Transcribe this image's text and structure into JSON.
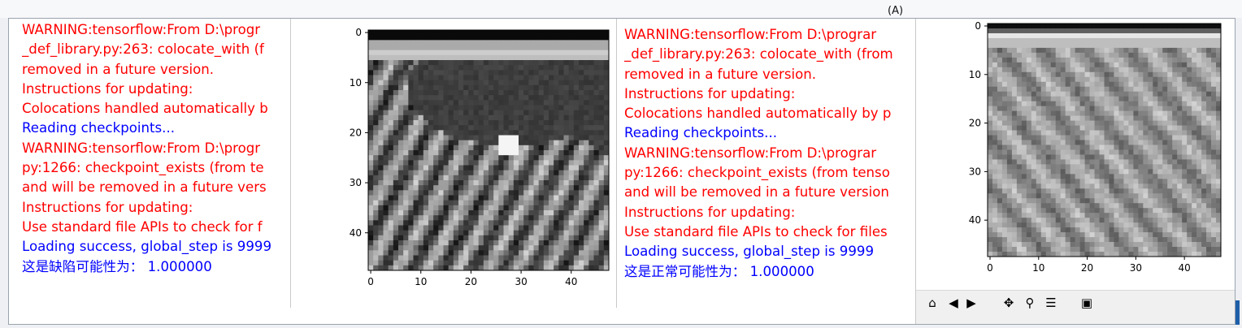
{
  "colors": {
    "warning_text": "#ff0000",
    "info_text": "#0000ff",
    "window_bg": "#ffffff",
    "desktop_bg": "#eef0f3"
  },
  "top_caption": "(A)",
  "console_left": {
    "lines": [
      {
        "text": "WARNING:tensorflow:From D:\\progr",
        "kind": "warning"
      },
      {
        "text": "_def_library.py:263: colocate_with (f",
        "kind": "warning"
      },
      {
        "text": "removed in a future version.",
        "kind": "warning"
      },
      {
        "text": "Instructions for updating:",
        "kind": "warning"
      },
      {
        "text": "Colocations handled automatically b",
        "kind": "warning"
      },
      {
        "text": "Reading checkpoints...",
        "kind": "info"
      },
      {
        "text": "WARNING:tensorflow:From D:\\progr",
        "kind": "warning"
      },
      {
        "text": "py:1266: checkpoint_exists (from te",
        "kind": "warning"
      },
      {
        "text": "and will be removed in a future vers",
        "kind": "warning"
      },
      {
        "text": "Instructions for updating:",
        "kind": "warning"
      },
      {
        "text": "Use standard file APIs to check for f",
        "kind": "warning"
      },
      {
        "text": "Loading success, global_step is 9999",
        "kind": "info"
      },
      {
        "text": "这是缺陷可能性为： 1.000000",
        "kind": "info"
      }
    ]
  },
  "console_right": {
    "lines": [
      {
        "text": "WARNING:tensorflow:From D:\\prograr",
        "kind": "warning"
      },
      {
        "text": "_def_library.py:263: colocate_with (from",
        "kind": "warning"
      },
      {
        "text": "removed in a future version.",
        "kind": "warning"
      },
      {
        "text": "Instructions for updating:",
        "kind": "warning"
      },
      {
        "text": "Colocations handled automatically by p",
        "kind": "warning"
      },
      {
        "text": "Reading checkpoints...",
        "kind": "info"
      },
      {
        "text": "WARNING:tensorflow:From D:\\prograr",
        "kind": "warning"
      },
      {
        "text": "py:1266: checkpoint_exists (from tenso",
        "kind": "warning"
      },
      {
        "text": "and will be removed in a future version",
        "kind": "warning"
      },
      {
        "text": "Instructions for updating:",
        "kind": "warning"
      },
      {
        "text": "Use standard file APIs to check for files",
        "kind": "warning"
      },
      {
        "text": "Loading success, global_step is 9999",
        "kind": "info"
      },
      {
        "text": "这是正常可能性为： 1.000000",
        "kind": "info"
      }
    ]
  },
  "plot_left": {
    "x_ticks": [
      "0",
      "10",
      "20",
      "30",
      "40"
    ],
    "y_ticks": [
      "0",
      "10",
      "20",
      "30",
      "40"
    ]
  },
  "plot_right": {
    "x_ticks": [
      "0",
      "10",
      "20",
      "30",
      "40"
    ],
    "y_ticks": [
      "0",
      "10",
      "20",
      "30",
      "40"
    ],
    "toolbar": [
      "home-icon",
      "back-icon",
      "forward-icon",
      "pan-icon",
      "zoom-icon",
      "configure-icon",
      "save-icon"
    ]
  },
  "chart_data": [
    {
      "type": "heatmap",
      "title": "",
      "xlabel": "",
      "ylabel": "",
      "xlim": [
        -0.5,
        47.5
      ],
      "ylim": [
        47.5,
        -0.5
      ],
      "x_ticks": [
        0,
        10,
        20,
        30,
        40
      ],
      "y_ticks": [
        0,
        10,
        20,
        30,
        40
      ],
      "colormap": "gray"
    },
    {
      "type": "heatmap",
      "title": "",
      "xlabel": "",
      "ylabel": "",
      "xlim": [
        -0.5,
        47.5
      ],
      "ylim": [
        47.5,
        -0.5
      ],
      "x_ticks": [
        0,
        10,
        20,
        30,
        40
      ],
      "y_ticks": [
        0,
        10,
        20,
        30,
        40
      ],
      "colormap": "gray"
    }
  ]
}
